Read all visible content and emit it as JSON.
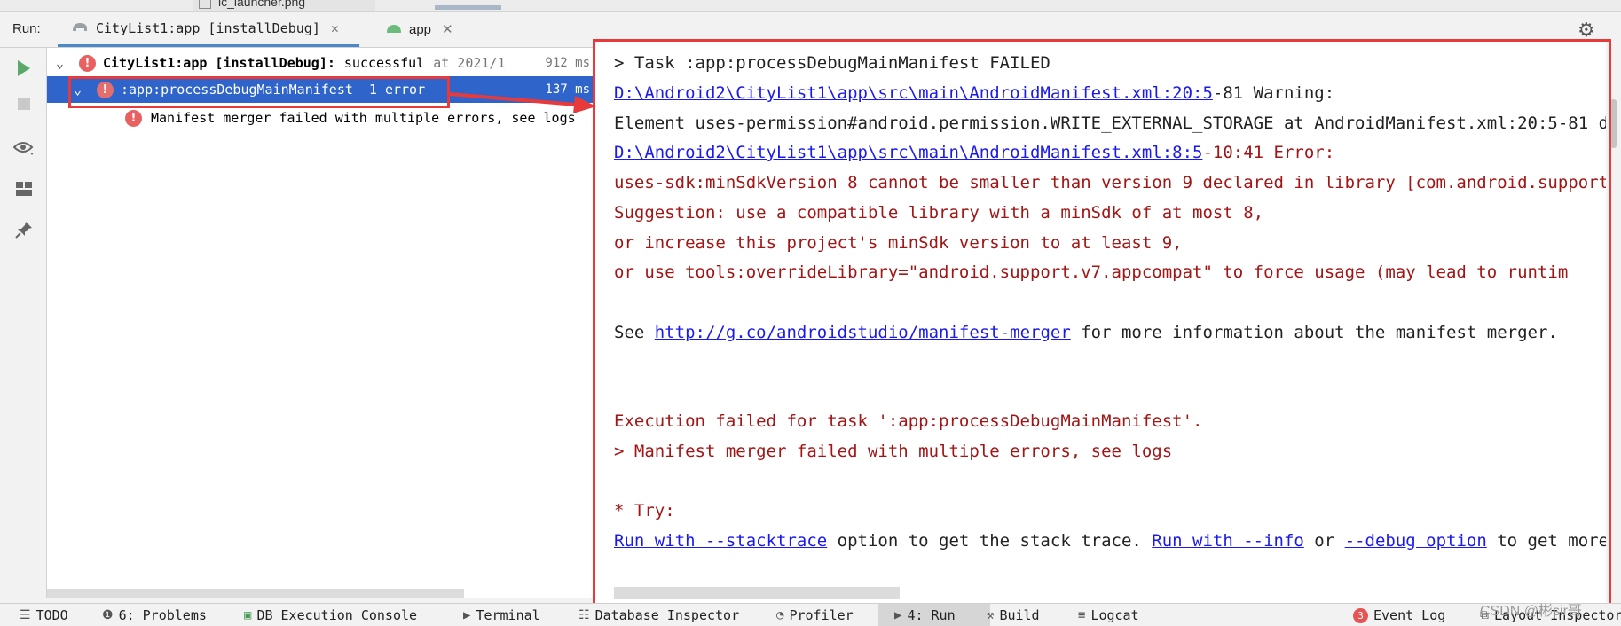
{
  "top_file_tab": {
    "label": "ic_launcher.png"
  },
  "run_header": {
    "run_label": "Run:",
    "tabs": [
      {
        "label": "CityList1:app [installDebug]",
        "icon": "elephant-icon"
      },
      {
        "label": "app",
        "icon": "android-icon"
      }
    ]
  },
  "tree": {
    "root": {
      "name": "CityList1:app [installDebug]:",
      "status": "successful",
      "at": "at 2021/1",
      "time": "912 ms"
    },
    "selected": {
      "name": ":app:processDebugMainManifest",
      "count": "1 error",
      "time": "137 ms"
    },
    "child": {
      "message": "Manifest merger failed with multiple errors, see logs"
    }
  },
  "console": {
    "lines": [
      "> Task :app:processDebugMainManifest FAILED",
      "D:\\Android2\\CityList1\\app\\src\\main\\AndroidManifest.xml:20:5",
      "-81 Warning:",
      "    Element uses-permission#android.permission.WRITE_EXTERNAL_STORAGE at AndroidManifest.xml:20:5-81 d",
      "D:\\Android2\\CityList1\\app\\src\\main\\AndroidManifest.xml:8:5",
      "-10:41 Error:",
      "    uses-sdk:minSdkVersion 8 cannot be smaller than version 9 declared in library [com.android.support",
      "    Suggestion: use a compatible library with a minSdk of at most 8,",
      "        or increase this project's minSdk version to at least 9,",
      "        or use tools:overrideLibrary=\"android.support.v7.appcompat\" to force usage (may lead to runtim",
      "See ",
      "http://g.co/androidstudio/manifest-merger",
      " for more information about the manifest merger.",
      "Execution failed for task ':app:processDebugMainManifest'.",
      "> Manifest merger failed with multiple errors, see logs",
      "* Try:",
      "Run with --stacktrace",
      " option to get the stack trace. ",
      "Run with --info",
      " or ",
      "--debug option",
      " to get more log"
    ]
  },
  "bottom_bar": {
    "items": [
      "TODO",
      "6: Problems",
      "DB Execution Console",
      "Terminal",
      "Database Inspector",
      "Profiler",
      "4: Run",
      "Build",
      "Logcat",
      "Event Log",
      "Layout Inspector"
    ],
    "event_badge": "3"
  },
  "watermark": "CSDN @彬sir哥"
}
